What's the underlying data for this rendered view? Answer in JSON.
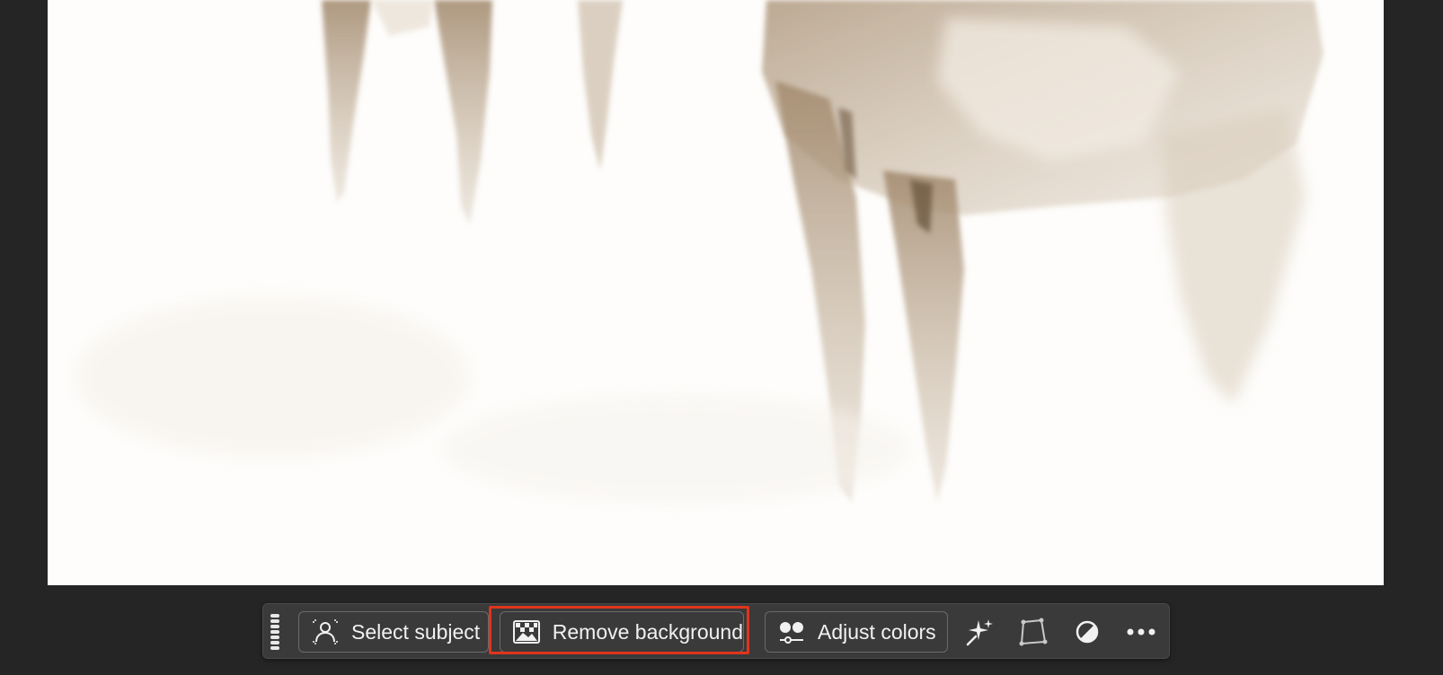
{
  "canvas": {
    "image_description_icon": "watercolor-painting-image"
  },
  "taskbar": {
    "grip_icon": "drag-handle-icon",
    "select_subject": {
      "label": "Select subject",
      "icon": "person-select-icon"
    },
    "remove_background": {
      "label": "Remove background",
      "icon": "remove-background-icon",
      "highlighted": true
    },
    "adjust_colors": {
      "label": "Adjust colors",
      "icon": "adjust-colors-icon"
    },
    "generative_fill": {
      "icon": "sparkle-icon"
    },
    "transform": {
      "icon": "transform-icon"
    },
    "adjustments": {
      "icon": "contrast-icon"
    },
    "more": {
      "icon": "more-icon"
    }
  },
  "colors": {
    "app_background": "#252525",
    "canvas_background": "#fefdfb",
    "taskbar_background": "#3a3a3a",
    "highlight": "#e0341b",
    "paint_brown": "#a8937a"
  }
}
